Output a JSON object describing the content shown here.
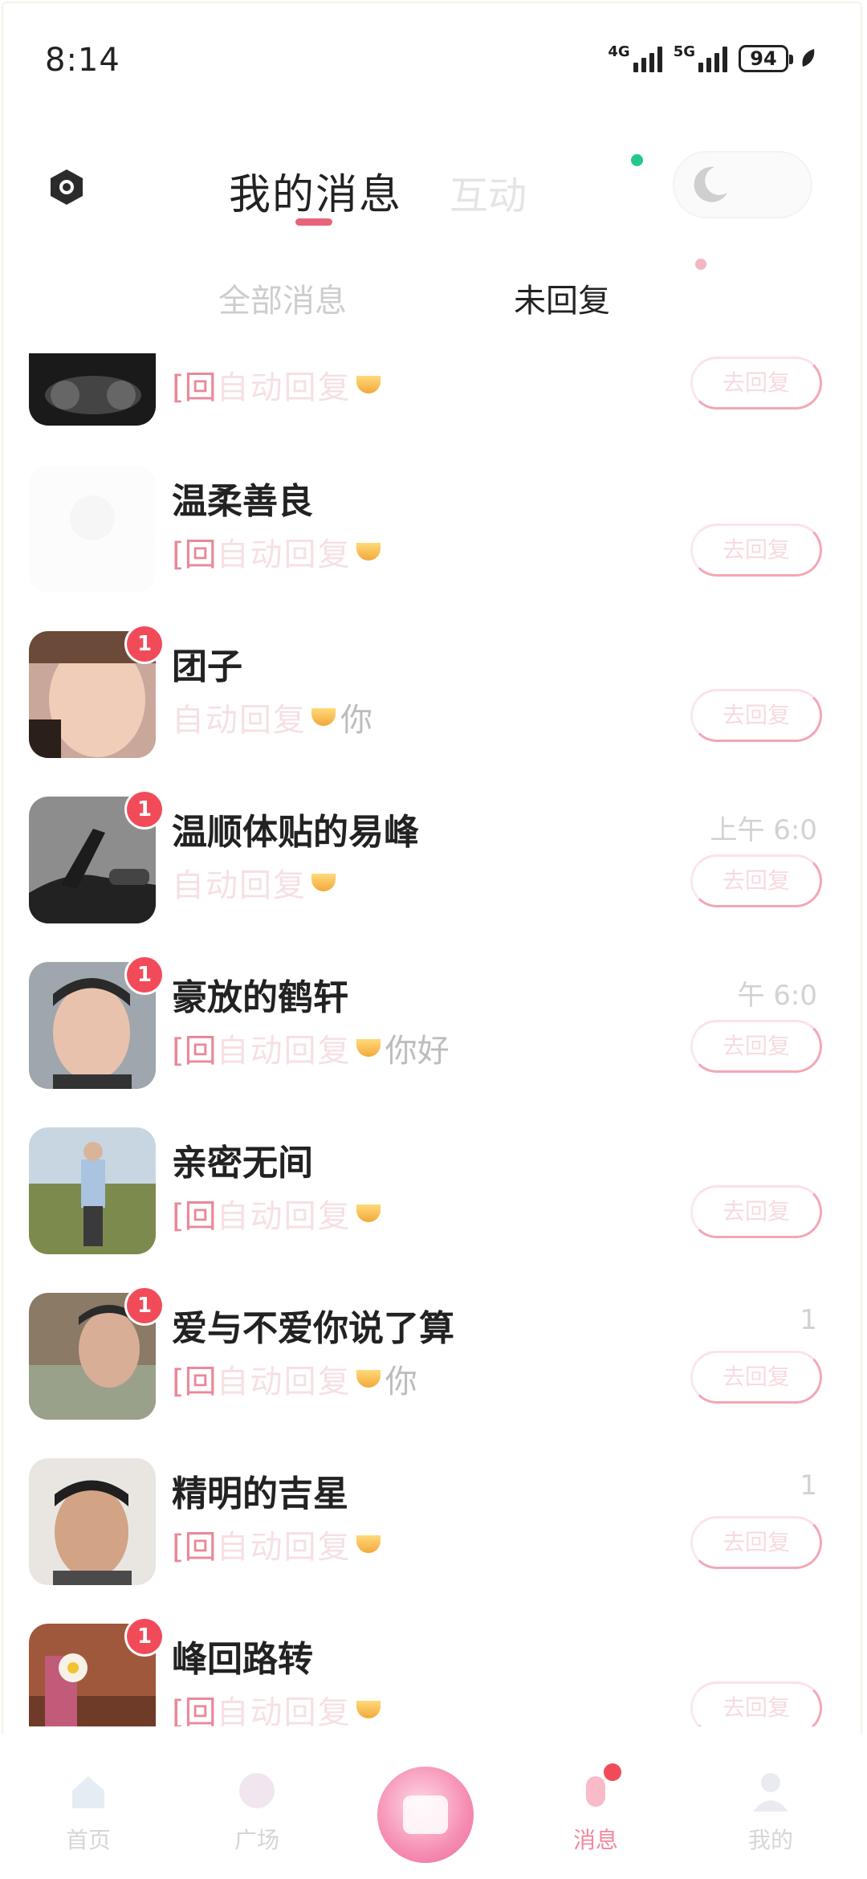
{
  "status_bar": {
    "time": "8:14",
    "network1": "4G",
    "network2": "5G",
    "battery": "94"
  },
  "header": {
    "active_tab": "我的消息",
    "inactive_tab": "互动",
    "accent_color": "#e9637a"
  },
  "sub_tabs": {
    "all": "全部消息",
    "unreplied": "未回复"
  },
  "messages": [
    {
      "name": "",
      "time": "",
      "prefix": "[回",
      "tail": "",
      "badge": ""
    },
    {
      "name": "温柔善良",
      "time": "",
      "prefix": "[回",
      "tail": "",
      "badge": ""
    },
    {
      "name": "团子",
      "time": "",
      "prefix": "",
      "tail": "你",
      "badge": "1"
    },
    {
      "name": "温顺体贴的易峰",
      "time": "上午 6:0",
      "prefix": "",
      "tail": "",
      "badge": "1"
    },
    {
      "name": "豪放的鹤轩",
      "time": "午 6:0",
      "prefix": "[回",
      "tail": "你好",
      "badge": "1"
    },
    {
      "name": "亲密无间",
      "time": "",
      "prefix": "[回",
      "tail": "",
      "badge": ""
    },
    {
      "name": "爱与不爱你说了算",
      "time": "1",
      "prefix": "[回",
      "tail": "你",
      "badge": "1"
    },
    {
      "name": "精明的吉星",
      "time": "1",
      "prefix": "[回",
      "tail": "",
      "badge": ""
    },
    {
      "name": "峰回路转",
      "time": "",
      "prefix": "[回",
      "tail": "",
      "badge": "1"
    }
  ],
  "bottom_nav": {
    "home": "首页",
    "plaza": "广场",
    "messages": "消息",
    "mine": "我的"
  }
}
